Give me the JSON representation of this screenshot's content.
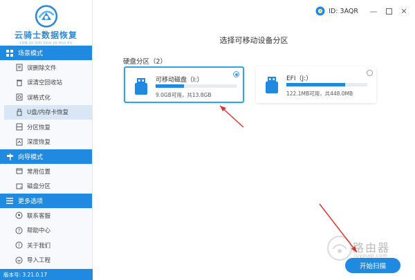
{
  "app": {
    "name": "云骑士数据恢复",
    "name_sub": "YUN QI SHI SHU JU HUI FU",
    "version": "版本号: 3.21.0.17",
    "user_id": "ID: 3AQR"
  },
  "colors": {
    "accent": "#1f8ae0",
    "selected_border": "#30a3e6",
    "arrow": "#d9342b"
  },
  "sidebar": {
    "sections": [
      {
        "title": "场景模式",
        "icon": "grid-icon",
        "items": [
          {
            "label": "误删除文件",
            "icon": "delete-file-icon"
          },
          {
            "label": "误清空回收站",
            "icon": "recycle-bin-icon"
          },
          {
            "label": "误格式化",
            "icon": "format-icon"
          },
          {
            "label": "U盘/内存卡恢复",
            "icon": "usb-icon",
            "active": true
          },
          {
            "label": "分区恢复",
            "icon": "partition-icon"
          },
          {
            "label": "深度恢复",
            "icon": "deep-scan-icon"
          }
        ]
      },
      {
        "title": "向导模式",
        "icon": "signpost-icon",
        "items": [
          {
            "label": "常用位置",
            "icon": "location-icon"
          },
          {
            "label": "磁盘分区",
            "icon": "disk-icon"
          }
        ]
      },
      {
        "title": "更多选项",
        "icon": "menu-icon",
        "items": [
          {
            "label": "联系客服",
            "icon": "support-icon"
          },
          {
            "label": "帮助中心",
            "icon": "help-icon"
          },
          {
            "label": "关于我们",
            "icon": "info-icon"
          },
          {
            "label": "导入工程",
            "icon": "import-icon"
          }
        ]
      }
    ]
  },
  "main": {
    "title": "选择可移动设备分区",
    "group_label": "硬盘分区（2）",
    "partitions": [
      {
        "name": "可移动磁盘（I:）",
        "capacity": "9.0GB可用，共13.8GB",
        "used_fraction": 0.35,
        "selected": true,
        "icon": "usb-drive-icon"
      },
      {
        "name": "EFI（J:）",
        "capacity": "122.1MB可用，共448.0MB",
        "used_fraction": 0.73,
        "selected": false,
        "icon": "usb-drive-icon"
      }
    ],
    "start_button": "开始扫描"
  },
  "watermark": {
    "text": "路由器",
    "sub": "luyouqi.com"
  }
}
